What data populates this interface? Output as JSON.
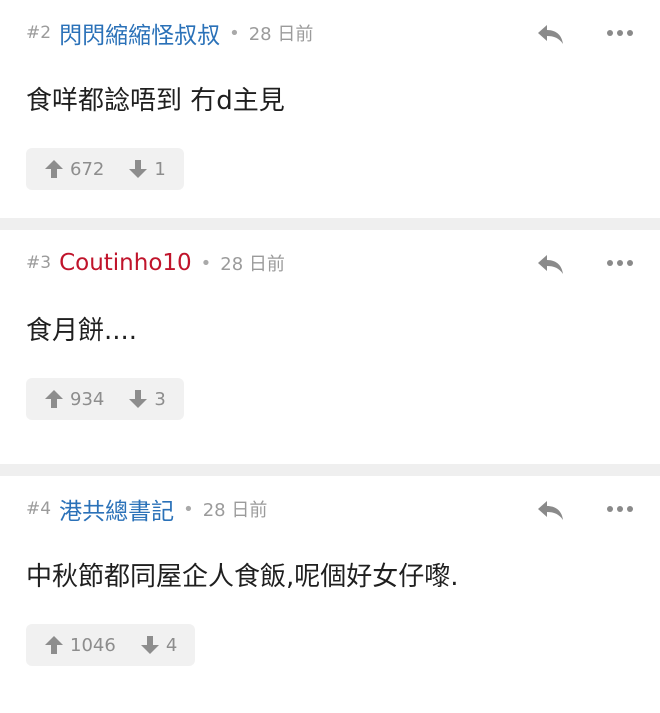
{
  "posts": [
    {
      "floor": "#2",
      "user": "閃閃縮縮怪叔叔",
      "user_color": "#2a71b8",
      "time": "28 日前",
      "content": "食咩都諗唔到 冇d主見",
      "upvotes": "672",
      "downvotes": "1"
    },
    {
      "floor": "#3",
      "user": "Coutinho10",
      "user_color": "#c0142b",
      "time": "28 日前",
      "content": "食月餅....",
      "upvotes": "934",
      "downvotes": "3"
    },
    {
      "floor": "#4",
      "user": "港共總書記",
      "user_color": "#2a71b8",
      "time": "28 日前",
      "content": "中秋節都同屋企人食飯,呢個好女仔嚟.",
      "upvotes": "1046",
      "downvotes": "4"
    }
  ],
  "separator": "•",
  "icons": {
    "reply": "reply-icon",
    "more": "more-icon",
    "upvote": "arrow-up-icon",
    "downvote": "arrow-down-icon"
  },
  "colors": {
    "username_blue": "#2a71b8",
    "username_red": "#c0142b",
    "muted": "#9b9b9b",
    "vote_bg": "#f1f1f1"
  }
}
